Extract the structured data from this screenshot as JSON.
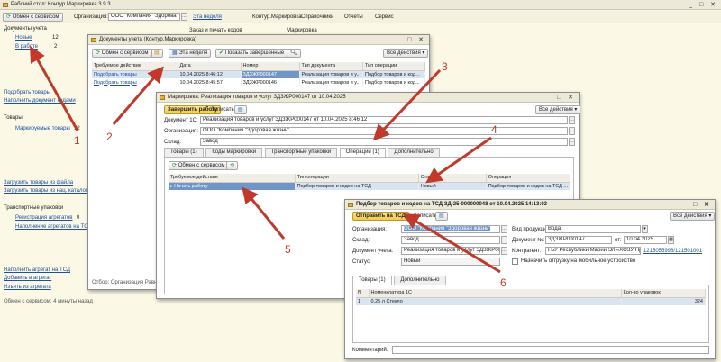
{
  "main_window": {
    "title": "Рабочий стол: Контур.Маркировка 3.9.3",
    "toolbar": {
      "exchange_label": "Обмен с сервисом",
      "org_label": "Организация:",
      "org_value": "ООО \"Компания \"Здорова",
      "period_label": "Эта неделя",
      "menu_kontur": "Контур.Маркировка",
      "menu_refs": "Справочники",
      "menu_reports": "Отчеты",
      "menu_service": "Сервис"
    },
    "sidebar": {
      "docs_heading": "Документы учета",
      "new_label": "Новые",
      "new_count": "12",
      "inwork_label": "В работе",
      "inwork_count": "2",
      "select_goods": "Подобрать товары",
      "fill_doc": "Наполнить документ кодами",
      "goods_heading": "Товары",
      "marked_goods": "Маркируемые товары",
      "marked_count": "12",
      "load_file": "Загрузить товары из файла",
      "load_catalog": "Загрузить товары из нац. каталога",
      "transport_heading": "Транспортные упаковки",
      "reg_aggregates": "Регистрация агрегатов",
      "reg_count": "0",
      "fill_aggregates": "Наполнение агрегатов на ТСД",
      "fill_count": "0",
      "fill_tsd": "Наполнить агрегат на ТСД",
      "add_aggregate": "Добавить в агрегат",
      "remove_aggregate": "Изъять из агрегата",
      "exchange_status": "Обмен с сервисом: 4 минуты назад"
    },
    "sections": {
      "orders": "Заказ и печать кодов",
      "marking": "Маркировка"
    }
  },
  "docs_window": {
    "title": "Документы учета (Контур.Маркировка)",
    "toolbar": {
      "period": "Эта неделя",
      "show_done": "Показать завершенные",
      "all_actions": "Все действия",
      "exchange": "Обмен с сервисом"
    },
    "columns": [
      "Требуемое действие",
      "Дата",
      "Номер",
      "Тип документа",
      "Тип операции"
    ],
    "rows": [
      {
        "action": "Подобрать товары",
        "date": "10.04.2025 8:46:12",
        "number": "ЗДЗЖР000147",
        "doc_type": "Реализация товаров и у...",
        "op_type": "Подбор товаров и код..."
      },
      {
        "action": "Подобрать товары",
        "date": "10.04.2025 8:45:57",
        "number": "ЗДЗЖР000146",
        "doc_type": "Реализация товаров и у...",
        "op_type": "Подбор товаров и код..."
      }
    ],
    "footer": "Отбор: Организация Равно"
  },
  "marking_window": {
    "title": "Маркировка: Реализация товаров и услуг ЗДЗЖР000147 от 10.04.2025",
    "toolbar": {
      "finish": "Завершить работу",
      "save": "Записать",
      "all_actions": "Все действия"
    },
    "doc1c_label": "Документ 1С:",
    "doc1c_value": "Реализация товаров и услуг ЗДЗЖР000147 от 10.04.2025 8:46:12",
    "org_label": "Организация:",
    "org_value": "ООО \"Компания \"Здоровая жизнь\"",
    "warehouse_label": "Склад:",
    "warehouse_value": "Завод",
    "tabs": [
      "Товары (1)",
      "Коды маркировки",
      "Транспортные упаковки",
      "Операции (1)",
      "Дополнительно"
    ],
    "ops_exchange": "Обмен с сервисом",
    "ops_columns": [
      "Требуемое действие",
      "Тип операции",
      "Статус",
      "Операция"
    ],
    "ops_row": {
      "action": "Начать работу",
      "op_type": "Подбор товаров и кодов на ТСД",
      "status": "Новый",
      "operation": "Подбор товаров и кодов на ТСД ..."
    }
  },
  "tsd_window": {
    "title": "Подбор товаров и кодов на ТСД ЗД-25-000000048 от 10.04.2025 14:13:03",
    "toolbar": {
      "send": "Отправить на ТСД",
      "save": "Записать",
      "all_actions": "Все действия"
    },
    "org_label": "Организация:",
    "org_value": "ООО \"Компания \"Здоровая жизнь\"",
    "warehouse_label": "Склад:",
    "warehouse_value": "Завод",
    "doc_label": "Документ учета:",
    "doc_value": "Реализация товаров и услуг ЗДЗЖР000147 от 10.04.2025 8:46:12",
    "status_label": "Статус:",
    "status_value": "Новый",
    "product_kind_label": "Вид продукции:",
    "product_kind_value": "Вода",
    "docno_label": "Документ №:",
    "docno_value": "ЗДЗЖР000147",
    "date_label": "от:",
    "date_value": "10.04.2025",
    "counterparty_label": "Контрагент:",
    "counterparty_value": "ГБУ Республики Марий Эл «ХОЗУ Правительс",
    "counterparty_inn": "1215055996/121501001",
    "mobile_check": "Назначить отгрузку на мобильное устройство",
    "tabs": [
      "Товары (1)",
      "Дополнительно"
    ],
    "columns": [
      "N",
      "Номенклатура 1С",
      "Кол-во упаковок"
    ],
    "row": {
      "n": "1",
      "name": "0,25 л Стекло",
      "qty": "324"
    },
    "comment_label": "Комментарий:"
  },
  "annotations": [
    "1",
    "2",
    "3",
    "4",
    "5",
    "6"
  ],
  "colors": {
    "arrow": "#c0392b",
    "selection": "#6f95c9",
    "accent_button": "#f2c94c"
  }
}
